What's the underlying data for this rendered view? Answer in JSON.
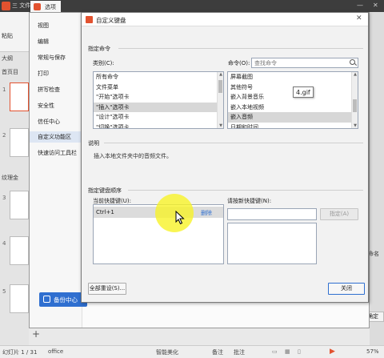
{
  "app": {
    "file_menu": "三 文件",
    "tab_title": "选项",
    "paste_label": "粘贴",
    "left_labels": [
      "大纲",
      "首页目",
      "",
      "纹理金"
    ],
    "slide_numbers": [
      "1",
      "2",
      "3",
      "4",
      "5",
      "6"
    ],
    "right_edge_text": "命名",
    "confirm_label": "确定"
  },
  "statusbar": {
    "slide_count": "幻灯片 1 / 31",
    "theme": "office",
    "smart_beautify": "智能美化",
    "notes": "备注",
    "comments": "批注",
    "zoom": "57%"
  },
  "options_nav": {
    "items": [
      "视图",
      "编辑",
      "常规与保存",
      "打印",
      "拼写检查",
      "安全性",
      "信任中心",
      "自定义功能区",
      "快速访问工具栏"
    ],
    "active_index": 7,
    "backup_label": "备份中心"
  },
  "dialog": {
    "title": "自定义键盘",
    "specify_command": "指定命令",
    "category_label": "类别(C):",
    "categories": [
      "所有命令",
      "文件菜单",
      "\"开始\"选项卡",
      "\"插入\"选项卡",
      "\"设计\"选项卡",
      "\"切换\"选项卡"
    ],
    "category_selected_index": 3,
    "command_label": "命令(O):",
    "search_placeholder": "查找命令",
    "commands": [
      "屏幕截图",
      "其他符号",
      "嵌入背景音乐",
      "嵌入本地视频",
      "嵌入音频",
      "日期和时间"
    ],
    "command_selected_index": 4,
    "tooltip": "4.gif",
    "description_header": "说明",
    "description_text": "插入本地文件夹中的音频文件。",
    "keyboard_sequence_header": "指定键盘顺序",
    "current_shortcut_label": "当前快捷键(U):",
    "current_shortcut": "Ctrl+1",
    "delete_label": "删除",
    "new_shortcut_label": "请按新快捷键(N):",
    "assign_button": "指定(A)",
    "reset_all_button": "全部重设(S)...",
    "close_button": "关闭"
  },
  "colors": {
    "accent_blue": "#2f6fd0",
    "wps_red": "#e2522f",
    "cursor_highlight": "#f8f228"
  }
}
